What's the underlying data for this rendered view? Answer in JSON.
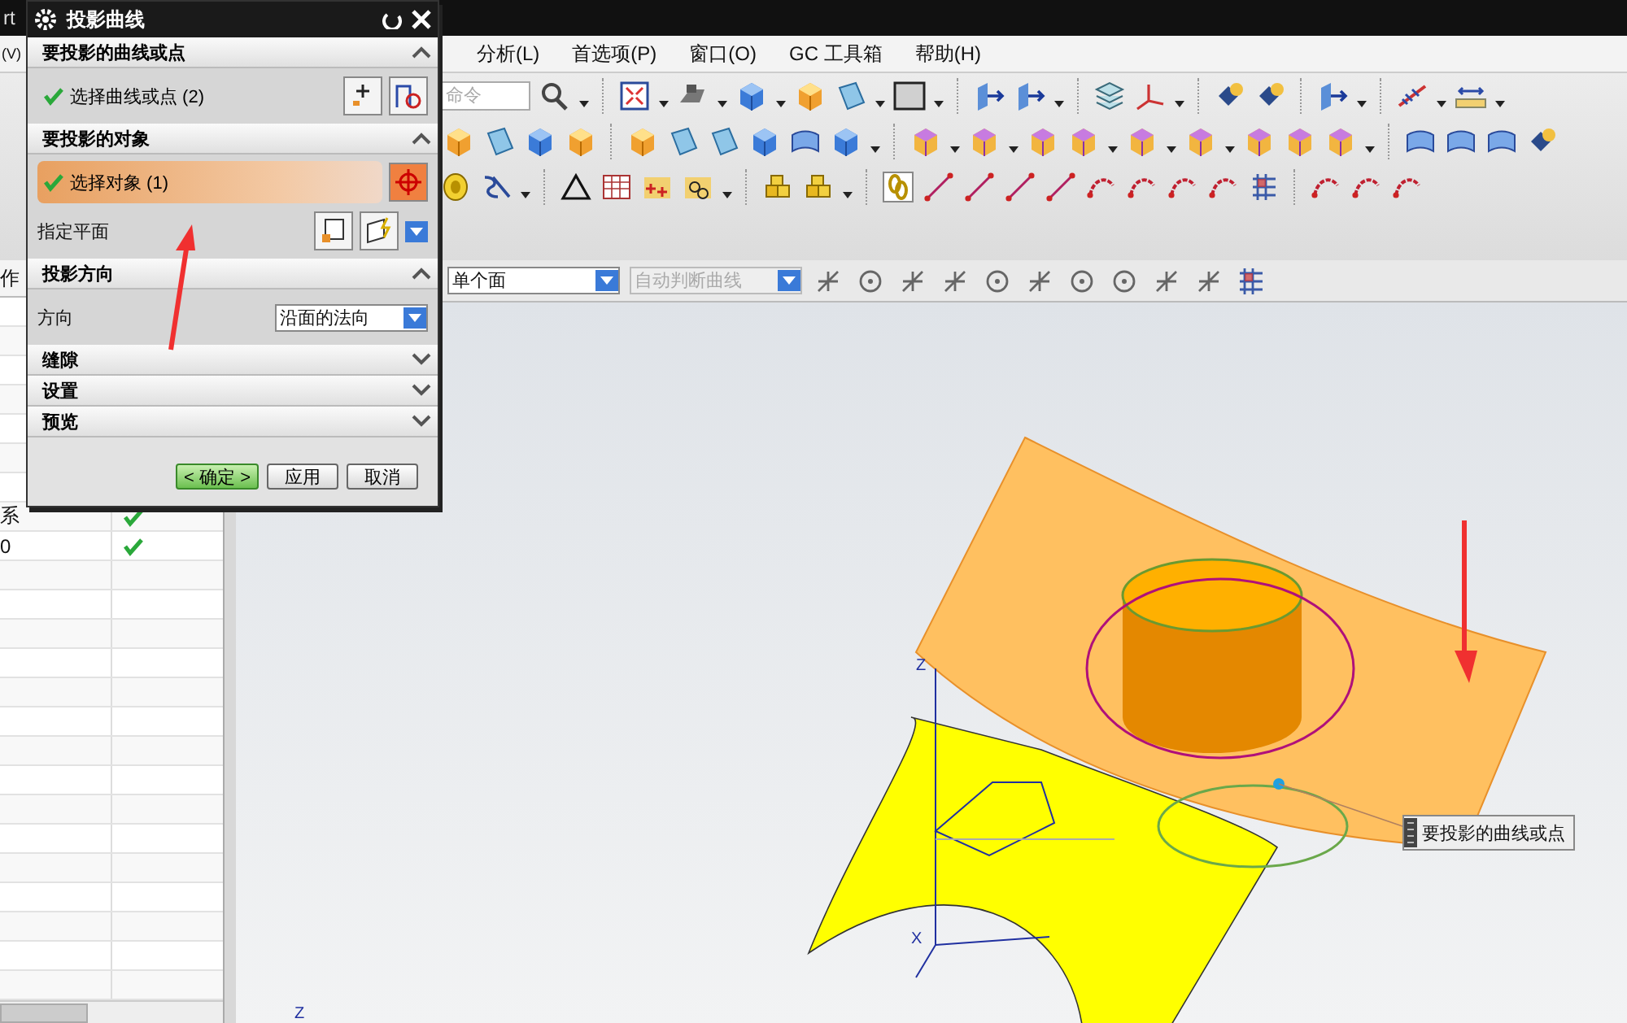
{
  "window": {
    "title_fragment": "rt"
  },
  "menu_bar": {
    "items": [
      "(V)",
      "分析(L)",
      "首选项(P)",
      "窗口(O)",
      "GC 工具箱",
      "帮助(H)"
    ]
  },
  "command_search": {
    "placeholder": "命令"
  },
  "selection_bar": {
    "filter": "单个面",
    "curve_rule": "自动判断曲线",
    "curve_rule_disabled": true
  },
  "part_navigator": {
    "header_fragment": "作",
    "rows": [
      {
        "name": "系",
        "checked": true
      },
      {
        "name": "0",
        "checked": true
      }
    ]
  },
  "dialog": {
    "title": "投影曲线",
    "sections": [
      {
        "title": "要投影的曲线或点",
        "expanded": true,
        "rows": [
          {
            "kind": "select",
            "label": "选择曲线或点 (2)",
            "done": true,
            "active": false
          }
        ]
      },
      {
        "title": "要投影的对象",
        "expanded": true,
        "rows": [
          {
            "kind": "select",
            "label": "选择对象 (1)",
            "done": true,
            "active": true
          },
          {
            "kind": "plane",
            "label": "指定平面"
          }
        ]
      },
      {
        "title": "投影方向",
        "expanded": true,
        "rows": [
          {
            "kind": "dropdown",
            "label": "方向",
            "value": "沿面的法向"
          }
        ]
      },
      {
        "title": "缝隙",
        "expanded": false
      },
      {
        "title": "设置",
        "expanded": false
      },
      {
        "title": "预览",
        "expanded": false
      }
    ],
    "buttons": [
      {
        "label": "< 确定 >",
        "primary": true
      },
      {
        "label": "应用",
        "primary": false
      },
      {
        "label": "取消",
        "primary": false
      }
    ]
  },
  "viewport": {
    "tooltip": "要投影的曲线或点",
    "axis_labels": [
      "Z",
      "X",
      "Z"
    ]
  }
}
